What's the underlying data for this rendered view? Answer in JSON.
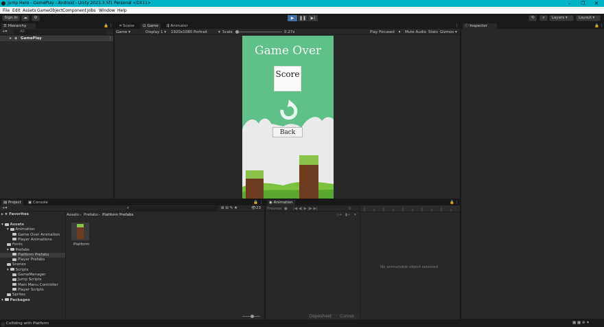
{
  "window": {
    "title": "Jump Hero - GamePlay - Android - Unity 2021.3.5f1 Personal <DX11>"
  },
  "menu": [
    "File",
    "Edit",
    "Assets",
    "GameObject",
    "Component",
    "Jobs",
    "Window",
    "Help"
  ],
  "toolbar": {
    "sign_in": "Sign in",
    "layers": "Layers",
    "layout": "Layout"
  },
  "hierarchy": {
    "tab": "Hierarchy",
    "search_placeholder": "All",
    "scene": "GamePlay"
  },
  "scene_tabs": {
    "scene": "Scene",
    "game": "Game",
    "animator": "Animator"
  },
  "game_bar": {
    "mode": "Game",
    "display": "Display 1",
    "resolution": "1920x1080 Portrait",
    "scale_label": "Scale",
    "scale_value": "0.27x",
    "play_focused": "Play Focused",
    "mute": "Mute Audio",
    "stats": "Stats",
    "gizmos": "Gizmos"
  },
  "game": {
    "title": "Game Over",
    "score_label": "Score",
    "back_button": "Back"
  },
  "inspector": {
    "tab": "Inspector"
  },
  "project": {
    "tab_project": "Project",
    "tab_console": "Console",
    "favorites": "Favorites",
    "breadcrumb": [
      "Assets",
      "Prefabs",
      "Platform Prefabs"
    ],
    "asset_count": "23",
    "asset_name": "Platform",
    "tree": [
      {
        "label": "Assets",
        "indent": 0,
        "bold": true
      },
      {
        "label": "Animation",
        "indent": 1
      },
      {
        "label": "Game Over Animation",
        "indent": 2
      },
      {
        "label": "Player Animations",
        "indent": 2
      },
      {
        "label": "Fonts",
        "indent": 1
      },
      {
        "label": "Prefabs",
        "indent": 1
      },
      {
        "label": "Platform Prefabs",
        "indent": 2,
        "selected": true
      },
      {
        "label": "Player Prefabs",
        "indent": 2
      },
      {
        "label": "Scenes",
        "indent": 1
      },
      {
        "label": "Scripts",
        "indent": 1
      },
      {
        "label": "GameManager",
        "indent": 2
      },
      {
        "label": "Jump Scripts",
        "indent": 2
      },
      {
        "label": "Main Menu Controller",
        "indent": 2
      },
      {
        "label": "Player Scripts",
        "indent": 2
      },
      {
        "label": "Sprites",
        "indent": 1
      },
      {
        "label": "Packages",
        "indent": 0,
        "bold": true
      }
    ]
  },
  "animation": {
    "tab": "Animation",
    "preview": "Preview",
    "frame": "0",
    "empty_msg": "No animatable object selected.",
    "dopesheet": "Dopesheet",
    "curves": "Curves"
  },
  "status": {
    "message": "Colliding with Platform"
  }
}
